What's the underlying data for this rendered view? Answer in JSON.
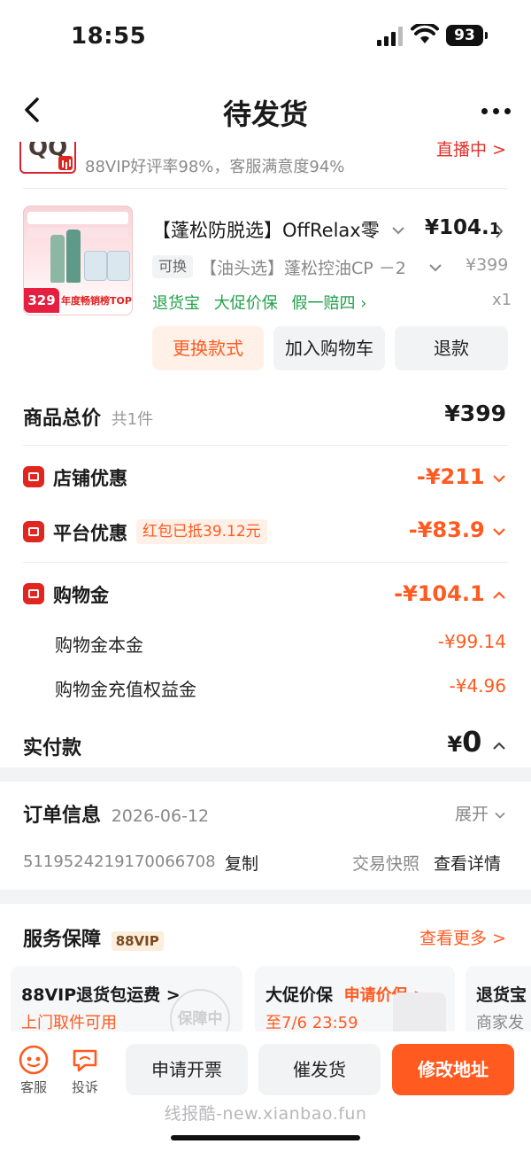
{
  "status_bar": {
    "time": "18:55",
    "battery": "93"
  },
  "nav": {
    "title": "待发货"
  },
  "shop": {
    "rating_text": "88VIP好评率98%，客服满意度94%",
    "live_label": "直播中 >"
  },
  "product": {
    "title": "【蓬松防脱选】OffRelax零",
    "price_main": "¥104.",
    "price_decimal": "1",
    "swap_badge": "可换",
    "sku": "【油头选】蓬松控油CP －2",
    "original_price": "¥399",
    "guarantees": [
      "退货宝",
      "大促价保",
      "假一赔四"
    ],
    "quantity": "x1",
    "thumb_price": "329",
    "thumb_rank": "年度畅销榜TOP1"
  },
  "actions": {
    "change_style": "更换款式",
    "add_cart": "加入购物车",
    "refund": "退款"
  },
  "summary": {
    "total_label": "商品总价",
    "total_count": "共1件",
    "total_value": "¥399",
    "shop_discount_label": "店铺优惠",
    "shop_discount_value": "-¥211",
    "platform_discount_label": "平台优惠",
    "platform_tag": "红包已抵39.12元",
    "platform_discount_value": "-¥83.9",
    "gold_label": "购物金",
    "gold_value": "-¥104.1",
    "gold_principal_label": "购物金本金",
    "gold_principal_value": "-¥99.14",
    "gold_bonus_label": "购物金充值权益金",
    "gold_bonus_value": "-¥4.96",
    "paid_label": "实付款",
    "paid_currency": "¥",
    "paid_value": "0"
  },
  "order_info": {
    "title": "订单信息",
    "date": "2026-06-12",
    "expand": "展开",
    "order_no": "5119524219170066708",
    "copy": "复制",
    "snapshot": "交易快照",
    "details": "查看详情"
  },
  "service": {
    "title": "服务保障",
    "vip_tag": "88VIP",
    "more": "查看更多 >",
    "cards": [
      {
        "title": "88VIP退货包运费 >",
        "sub": "上门取件可用",
        "stamp": "保障中"
      },
      {
        "title": "大促价保",
        "action": "申请价保 >",
        "sub": "至7/6 23:59"
      },
      {
        "title": "退货宝",
        "sub": "商家发"
      }
    ]
  },
  "bottom_bar": {
    "service_label": "客服",
    "complaint_label": "投诉",
    "invoice": "申请开票",
    "urge": "催发货",
    "change_address": "修改地址"
  },
  "watermark": "线报酷-new.xianbao.fun",
  "colors": {
    "accent": "#ff5a1f",
    "green": "#21a14a",
    "red": "#e0261f"
  }
}
